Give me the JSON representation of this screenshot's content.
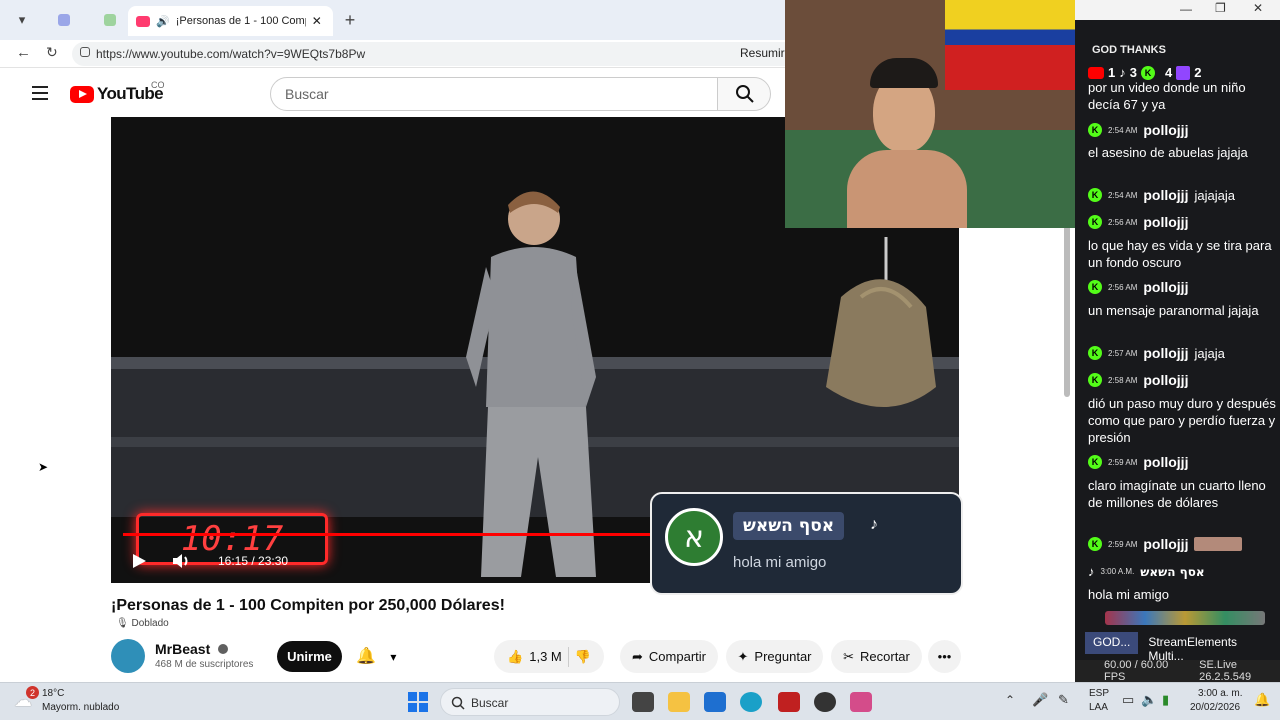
{
  "browser": {
    "tab_title": "¡Personas de 1 - 100 Compite",
    "url": "https://www.youtube.com/watch?v=9WEQts7b8Pw",
    "resume_label": "Resumir"
  },
  "youtube": {
    "logo_text": "YouTube",
    "country_code": "CO",
    "search_placeholder": "Buscar",
    "video": {
      "timer_overlay": "10:17",
      "time_readout": "16:15 / 23:30",
      "progress": 0.69
    },
    "notification": {
      "avatar_letter": "א",
      "username": "אסף השאש",
      "message": "hola mi amigo"
    },
    "title": "¡Personas de 1 - 100 Compiten por 250,000 Dólares!",
    "dubbed_label": "Doblado",
    "channel": {
      "name": "MrBeast",
      "subscribers": "468 M de suscriptores",
      "join_label": "Unirme"
    },
    "actions": {
      "likes": "1,3 M",
      "share": "Compartir",
      "ask": "Preguntar",
      "clip": "Recortar"
    }
  },
  "chat": {
    "title": "GOD THANKS",
    "counts": {
      "youtube": "1",
      "tiktok": "3",
      "kick": "4",
      "twitch": "2"
    },
    "messages": [
      {
        "text": "por un video donde un niño decía 67 y ya"
      },
      {
        "time": "2:54 AM",
        "user": "pollojjj",
        "text": "el asesino de abuelas jajaja"
      },
      {
        "time": "2:54 AM",
        "user": "pollojjj",
        "text": "jajajaja"
      },
      {
        "time": "2:56 AM",
        "user": "pollojjj",
        "text": "lo que hay es vida y se tira para un fondo oscuro"
      },
      {
        "time": "2:56 AM",
        "user": "pollojjj",
        "text": "un mensaje paranormal jajaja"
      },
      {
        "time": "2:57 AM",
        "user": "pollojjj",
        "text": "jajaja"
      },
      {
        "time": "2:58 AM",
        "user": "pollojjj",
        "text": "dió un paso muy duro y después como que paro y perdío fuerza y presión"
      },
      {
        "time": "2:59 AM",
        "user": "pollojjj",
        "text": "claro imagínate un cuarto lleno de millones de dólares"
      },
      {
        "time": "2:59 AM",
        "user": "pollojjj",
        "text": ""
      },
      {
        "time": "3:00 A.M.",
        "user": "אסף השאש",
        "text": "hola mi amigo"
      }
    ],
    "tabs": [
      "GOD...",
      "StreamElements Multi..."
    ],
    "fps": "60.00 / 60.00 FPS",
    "version": "SE.Live 26.2.5.549"
  },
  "taskbar": {
    "weather_temp": "18°C",
    "weather_desc": "Mayorm. nublado",
    "weather_badge": "2",
    "search_label": "Buscar",
    "lang": "ESP",
    "lang_sub": "LAA",
    "time": "3:00 a. m.",
    "date": "20/02/2026"
  }
}
